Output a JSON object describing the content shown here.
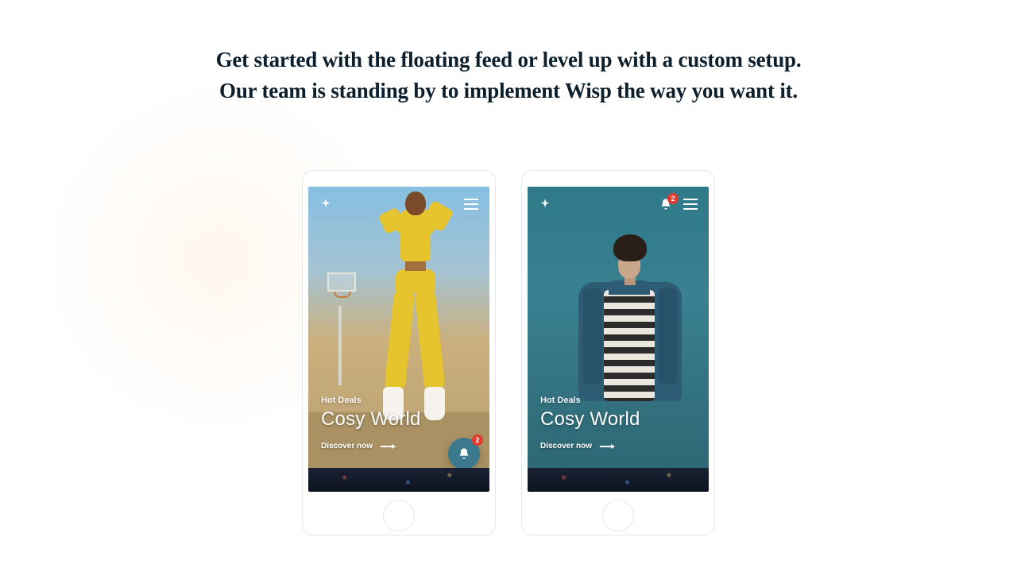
{
  "headline_line1": "Get started with the floating feed or level up with a custom setup.",
  "headline_line2": "Our team is standing by to implement Wisp the way you want it.",
  "badge_count": "2",
  "phones": {
    "left": {
      "eyebrow": "Hot Deals",
      "title": "Cosy World",
      "cta": "Discover now"
    },
    "right": {
      "eyebrow": "Hot Deals",
      "title": "Cosy World",
      "cta": "Discover now"
    }
  }
}
